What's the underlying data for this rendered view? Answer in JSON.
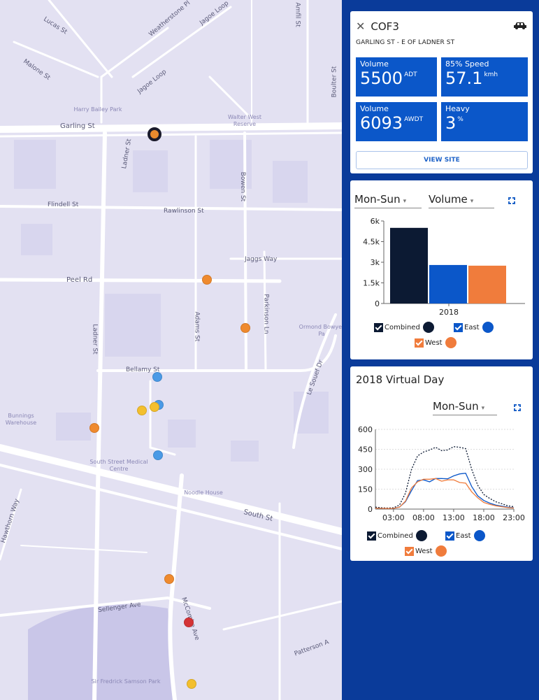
{
  "map": {
    "streets": {
      "lucas": "Lucas St",
      "malone": "Malone St",
      "jagoe_loop_top": "Jagoe Loop",
      "jagoe_loop": "Jagoe Loop",
      "weatherstone": "Weatherstone Pl",
      "amfil": "Amfil St",
      "boulter": "Boulter St",
      "garling": "Garling St",
      "ladner_top": "Ladner St",
      "ladner_bottom": "Ladner St",
      "bowen": "Bowen St",
      "flindell": "Flindell St",
      "rawlinson": "Rawlinson St",
      "jaggs": "Jaggs Way",
      "peel": "Peel Rd",
      "adams": "Adams St",
      "parkinson": "Parkinson Ln",
      "bellamy": "Bellamy St",
      "le_souef": "Le Souef Dr",
      "south": "South St",
      "hawthorn": "Hawthorn Way",
      "sellenger": "Sellenger Ave",
      "mccombe": "McCombe Ave",
      "patterson": "Patterson A"
    },
    "pois": {
      "harry_bailey": "Harry Bailey Park",
      "walter_west": "Walter West Reserve",
      "ormond": "Ormond Bowyer Pa",
      "bunnings": "Bunnings Warehouse",
      "medical": "South Street Medical Centre",
      "noodle": "Noodle House",
      "sir_fredrick": "Sir Fredrick Samson Park"
    },
    "marker_colors": {
      "selected": "#e8892e",
      "orange": "#ef8a2e",
      "blue": "#4a9ae6",
      "yellow": "#f3bf2e",
      "red": "#d43336"
    }
  },
  "site": {
    "close_icon": "close-icon",
    "id": "COF3",
    "vehicle_icon": "car-icon",
    "location": "GARLING ST - E OF LADNER ST",
    "tiles": [
      {
        "label": "Volume",
        "value": "5500",
        "unit": "ADT"
      },
      {
        "label": "85% Speed",
        "value": "57.1",
        "unit": "kmh"
      },
      {
        "label": "Volume",
        "value": "6093",
        "unit": "AWDT"
      },
      {
        "label": "Heavy",
        "value": "3",
        "unit": "%"
      }
    ],
    "view_button": "VIEW SITE"
  },
  "volume_chart": {
    "period_select": "Mon-Sun",
    "metric_select": "Volume",
    "legend": [
      "Combined",
      "East",
      "West"
    ]
  },
  "day_chart": {
    "title": "2018 Virtual Day",
    "period_select": "Mon-Sun",
    "legend": [
      "Combined",
      "East",
      "West"
    ]
  },
  "colors": {
    "panel_bg": "#0a3b9a",
    "tile_bg": "#0b57c9",
    "combined": "#0c1a33",
    "east": "#0b57c9",
    "west": "#f07c3c"
  },
  "chart_data": [
    {
      "type": "bar",
      "categories": [
        "2018"
      ],
      "series": [
        {
          "name": "Combined",
          "values": [
            5500
          ]
        },
        {
          "name": "East",
          "values": [
            2800
          ]
        },
        {
          "name": "West",
          "values": [
            2750
          ]
        }
      ],
      "yticks": [
        "0",
        "1.5k",
        "3k",
        "4.5k",
        "6k"
      ],
      "ylim": [
        0,
        6000
      ],
      "legend_position": "bottom"
    },
    {
      "type": "line",
      "x": [
        0,
        1,
        2,
        3,
        4,
        5,
        6,
        7,
        8,
        9,
        10,
        11,
        12,
        13,
        14,
        15,
        16,
        17,
        18,
        19,
        20,
        21,
        22,
        23
      ],
      "xticks": [
        "03:00",
        "08:00",
        "13:00",
        "18:00",
        "23:00"
      ],
      "xtick_hours": [
        3,
        8,
        13,
        18,
        23
      ],
      "yticks": [
        "0",
        "150",
        "300",
        "450",
        "600"
      ],
      "ylim": [
        0,
        600
      ],
      "series": [
        {
          "name": "Combined",
          "values": [
            15,
            10,
            8,
            10,
            30,
            120,
            300,
            400,
            430,
            445,
            465,
            440,
            445,
            470,
            465,
            455,
            300,
            180,
            110,
            80,
            55,
            40,
            25,
            18
          ]
        },
        {
          "name": "East",
          "values": [
            8,
            5,
            4,
            5,
            15,
            55,
            140,
            215,
            220,
            205,
            230,
            230,
            228,
            250,
            265,
            270,
            170,
            100,
            65,
            45,
            30,
            22,
            14,
            10
          ]
        },
        {
          "name": "West",
          "values": [
            7,
            5,
            4,
            5,
            15,
            60,
            160,
            205,
            225,
            225,
            230,
            210,
            220,
            220,
            200,
            195,
            130,
            85,
            50,
            35,
            25,
            18,
            11,
            8
          ]
        }
      ],
      "legend_position": "bottom"
    }
  ]
}
